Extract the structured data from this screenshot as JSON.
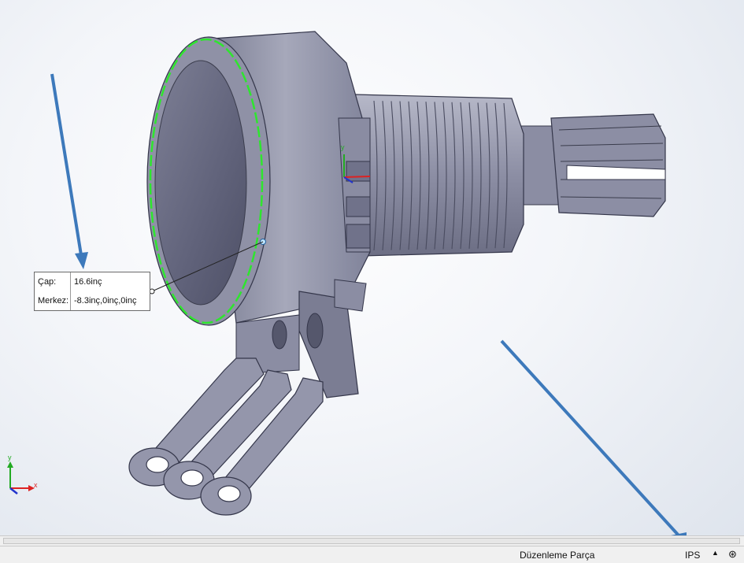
{
  "measure_tooltip": {
    "diameter_label": "Çap:",
    "diameter_value": "16.6inç",
    "center_label": "Merkez:",
    "center_value": "-8.3inç,0inç,0inç"
  },
  "triad": {
    "x": "x",
    "y": "y"
  },
  "statusbar": {
    "mode": "Düzenleme Parça",
    "units": "IPS",
    "units_caret": "▲",
    "help_icon": "⊛"
  },
  "colors": {
    "part_body": "#9a9cb0",
    "part_dark": "#6f7186",
    "selection": "#2ee62e",
    "annotation_arrow": "#3d79bb"
  }
}
